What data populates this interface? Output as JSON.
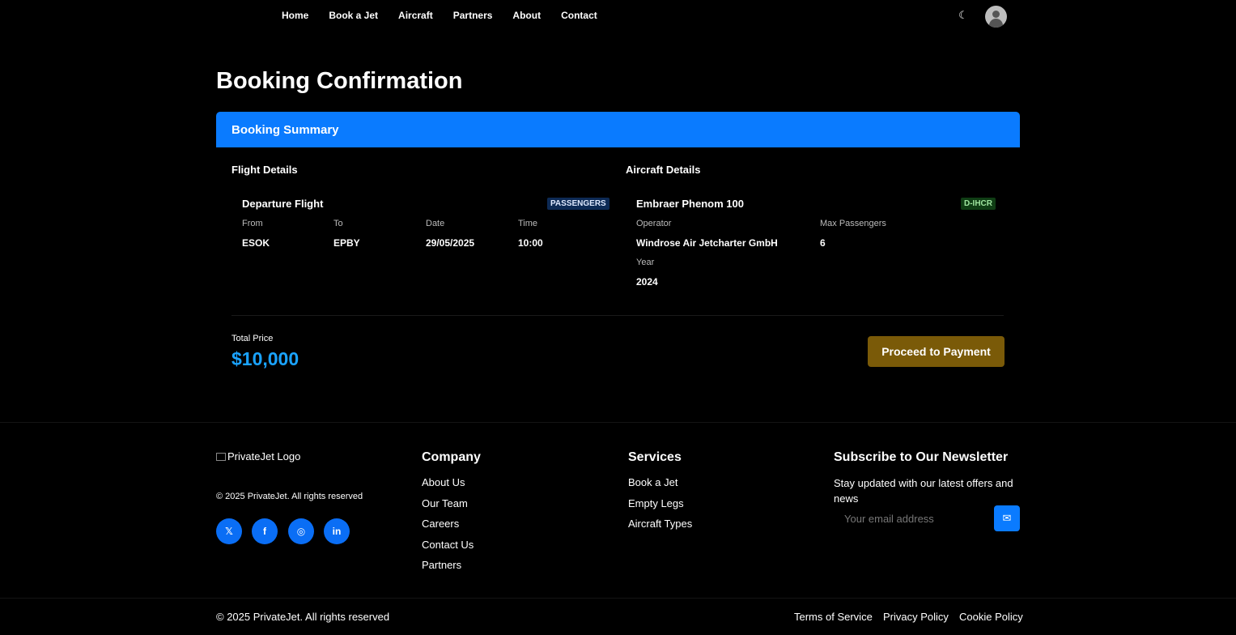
{
  "nav": {
    "links": [
      "Home",
      "Book a Jet",
      "Aircraft",
      "Partners",
      "About",
      "Contact"
    ],
    "theme_icon": "moon-icon",
    "avatar_icon": "user-avatar-icon"
  },
  "page": {
    "title": "Booking Confirmation"
  },
  "summary": {
    "header": "Booking Summary",
    "flight": {
      "section_title": "Flight Details",
      "card_title": "Departure Flight",
      "badge": "PASSENGERS",
      "labels": {
        "from": "From",
        "to": "To",
        "date": "Date",
        "time": "Time"
      },
      "values": {
        "from": "ESOK",
        "to": "EPBY",
        "date": "29/05/2025",
        "time": "10:00"
      }
    },
    "aircraft": {
      "section_title": "Aircraft Details",
      "card_title": "Embraer Phenom 100",
      "badge": "D-IHCR",
      "labels": {
        "operator": "Operator",
        "max_passengers": "Max Passengers",
        "year": "Year"
      },
      "values": {
        "operator": "Windrose Air Jetcharter GmbH",
        "max_passengers": "6",
        "year": "2024"
      }
    },
    "total_label": "Total Price",
    "total_value": "$10,000",
    "pay_button": "Proceed to Payment"
  },
  "footer": {
    "logo_alt": "PrivateJet Logo",
    "copyright": "© 2025 PrivateJet. All rights reserved",
    "social": [
      "twitter-icon",
      "facebook-icon",
      "instagram-icon",
      "linkedin-icon"
    ],
    "company": {
      "title": "Company",
      "links": [
        "About Us",
        "Our Team",
        "Careers",
        "Contact Us",
        "Partners"
      ]
    },
    "services": {
      "title": "Services",
      "links": [
        "Book a Jet",
        "Empty Legs",
        "Aircraft Types"
      ]
    },
    "newsletter": {
      "title": "Subscribe to Our Newsletter",
      "text": "Stay updated with our latest offers and news",
      "placeholder": "Your email address",
      "send_icon": "envelope-icon"
    },
    "bottom_copyright": "© 2025 PrivateJet. All rights reserved",
    "legal": [
      "Terms of Service",
      "Privacy Policy",
      "Cookie Policy"
    ]
  },
  "colors": {
    "accent": "#0a7bff",
    "price": "#1aa3ff",
    "pay_button": "#7a5a08"
  }
}
